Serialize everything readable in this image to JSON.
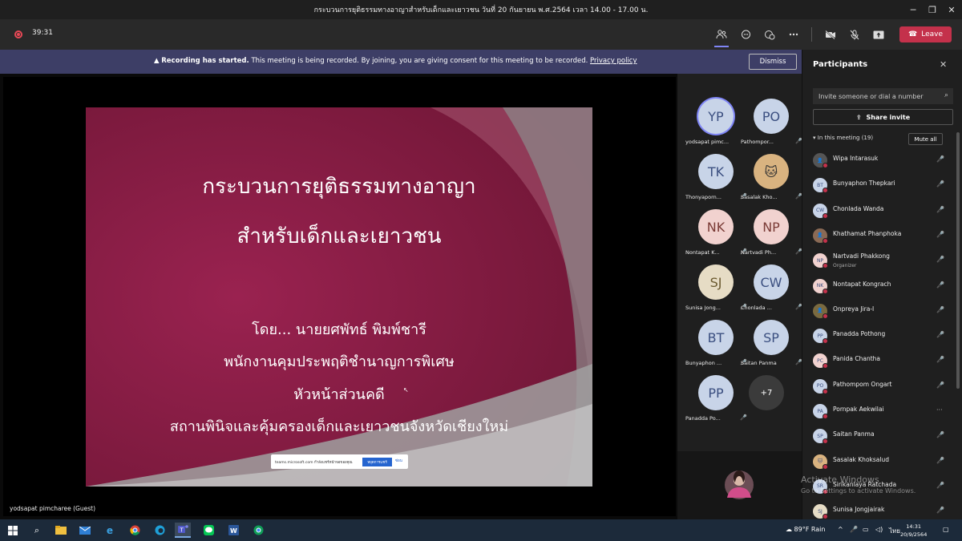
{
  "window": {
    "title": "กระบวนการยุติธรรมทางอาญาสำหรับเด็กและเยาวชน วันที่ 20 กันยายน พ.ศ.2564 เวลา 14.00 - 17.00 น.",
    "minimize": "─",
    "maximize": "❐",
    "close": "✕"
  },
  "toolbar": {
    "timer": "39:31",
    "leave_label": "Leave",
    "icons": [
      "participants-icon",
      "chat-icon",
      "reactions-icon",
      "more-icon",
      "camera-off-icon",
      "mic-off-icon",
      "share-icon"
    ]
  },
  "banner": {
    "bold": "Recording has started.",
    "text": "This meeting is being recorded. By joining, you are giving consent for this meeting to be recorded.",
    "link": "Privacy policy",
    "dismiss": "Dismiss"
  },
  "slide": {
    "title_line1": "กระบวนการยุติธรรมทางอาญา",
    "title_line2": "สำหรับเด็กและเยาวชน",
    "line1": "โดย... นายยศพัทธ์  พิมพ์ชารี",
    "line2": "พนักงานคุมประพฤติชำนาญการพิเศษ",
    "line3": "หัวหน้าส่วนคดี",
    "line4": "สถานพินิจและคุ้มครองเด็กและเยาวชนจังหวัดเชียงใหม่",
    "share_bar_text": "teams.microsoft.com กำลังแชร์หน้าจอของคุณ",
    "share_bar_stop": "หยุดการแชร์",
    "share_bar_hide": "ซ่อน"
  },
  "presenter": "yodsapat pimcharee (Guest)",
  "gallery": {
    "tiles": [
      {
        "initials": "YP",
        "name": "yodsapat pimc...",
        "mic": ""
      },
      {
        "initials": "PO",
        "name": "Pathompor...",
        "mic": "🎤"
      },
      {
        "initials": "TK",
        "name": "Thonyaporn...",
        "mic": "🎤"
      },
      {
        "initials": "🐱",
        "name": "Sasalak Kho...",
        "mic": "🎤"
      },
      {
        "initials": "NK",
        "name": "Nontapat K...",
        "mic": "🎤"
      },
      {
        "initials": "NP",
        "name": "Nartvadi Ph...",
        "mic": "🎤"
      },
      {
        "initials": "SJ",
        "name": "Sunisa Jong...",
        "mic": "🎤"
      },
      {
        "initials": "CW",
        "name": "Chonlada ...",
        "mic": "🎤"
      },
      {
        "initials": "BT",
        "name": "Bunyaphon ...",
        "mic": "🎤"
      },
      {
        "initials": "SP",
        "name": "Saitan Panma",
        "mic": "🎤"
      },
      {
        "initials": "PP",
        "name": "Panadda Po...",
        "mic": "🎤"
      }
    ],
    "more": "+7",
    "colors": [
      "#c8d4e8",
      "#c8d4e8",
      "#c8d4e8",
      "#d9b380",
      "#f1d2cf",
      "#f1d2cf",
      "#e6dcc5",
      "#c8d4e8",
      "#c8d4e8",
      "#c8d4e8",
      "#c8d4e8"
    ],
    "text_colors": [
      "#3b4f80",
      "#3b4f80",
      "#3b4f80",
      "#333",
      "#7a3b36",
      "#7a3b36",
      "#6b5a30",
      "#3b4f80",
      "#3b4f80",
      "#3b4f80",
      "#3b4f80"
    ]
  },
  "panel": {
    "title": "Participants",
    "close": "✕",
    "invite_placeholder": "Invite someone or dial a number",
    "share_invite": "Share invite",
    "in_meeting": "In this meeting (19)",
    "mute_all": "Mute all",
    "participants": [
      {
        "initials": "👤",
        "name": "Wipa Intarasuk",
        "sub": "",
        "mic": "🎤"
      },
      {
        "initials": "BT",
        "name": "Bunyaphon Thepkari",
        "sub": "",
        "mic": "🎤"
      },
      {
        "initials": "CW",
        "name": "Chonlada Wanda",
        "sub": "",
        "mic": "🎤"
      },
      {
        "initials": "👤",
        "name": "Khathamat Phanphoka",
        "sub": "",
        "mic": "🎤"
      },
      {
        "initials": "NP",
        "name": "Nartvadi Phakkong",
        "sub": "Organizer",
        "mic": "🎤"
      },
      {
        "initials": "NK",
        "name": "Nontapat Kongrach",
        "sub": "",
        "mic": "🎤"
      },
      {
        "initials": "👤",
        "name": "Onpreya Jira-I",
        "sub": "",
        "mic": "🎤"
      },
      {
        "initials": "PP",
        "name": "Panadda Pothong",
        "sub": "",
        "mic": "🎤"
      },
      {
        "initials": "PC",
        "name": "Panida Chantha",
        "sub": "",
        "mic": "🎤"
      },
      {
        "initials": "PO",
        "name": "Pathompom Ongart",
        "sub": "",
        "mic": "🎤"
      },
      {
        "initials": "PA",
        "name": "Pornpak Aekwilai",
        "sub": "",
        "mic": "···"
      },
      {
        "initials": "SP",
        "name": "Saitan Panma",
        "sub": "",
        "mic": "🎤"
      },
      {
        "initials": "🐱",
        "name": "Sasalak Khoksalud",
        "sub": "",
        "mic": "🎤"
      },
      {
        "initials": "SR",
        "name": "Sirikanlaya Ratchada",
        "sub": "",
        "mic": "🎤"
      },
      {
        "initials": "SJ",
        "name": "Sunisa Jongjairak",
        "sub": "",
        "mic": "🎤"
      }
    ],
    "avatar_colors": [
      "#555",
      "#c8d4e8",
      "#c8d4e8",
      "#8a6a55",
      "#f1d2cf",
      "#f1d2cf",
      "#7a6a40",
      "#c8d4e8",
      "#f1d2cf",
      "#c8d4e8",
      "#c8d4e8",
      "#c8d4e8",
      "#d9b380",
      "#c8d4e8",
      "#e6dcc5"
    ]
  },
  "watermark": {
    "line1": "Activate Windows",
    "line2": "Go to Settings to activate Windows."
  },
  "taskbar": {
    "weather": "89°F  Rain",
    "lang": "ไทย",
    "time": "14:31",
    "date": "20/9/2564"
  }
}
